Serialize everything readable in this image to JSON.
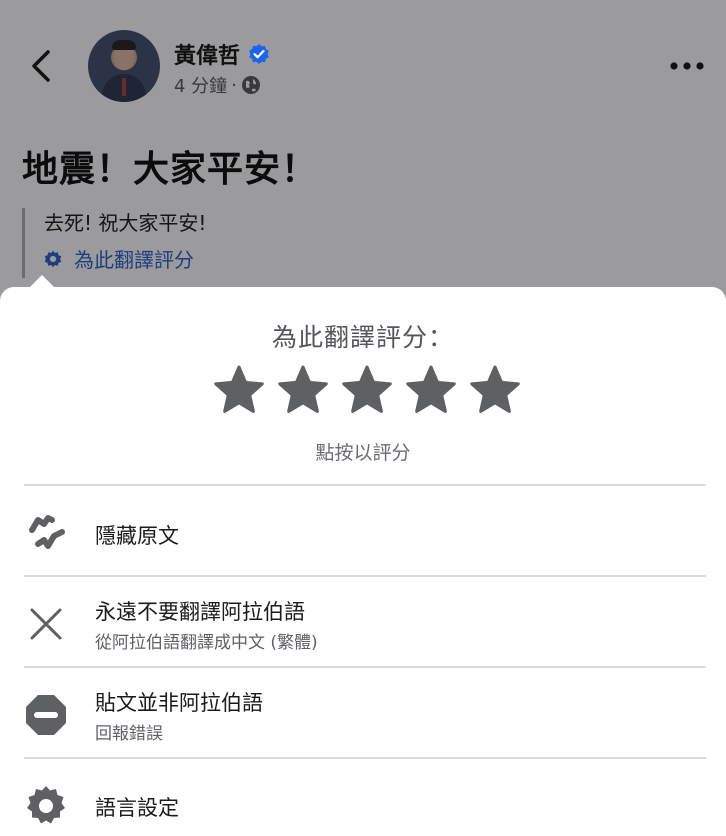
{
  "post": {
    "author": "黃偉哲",
    "time": "4 分鐘",
    "separator": "·",
    "content": "地震！大家平安！",
    "translation": "去死! 祝大家平安!",
    "rate_link": "為此翻譯評分"
  },
  "rating": {
    "title": "為此翻譯評分：",
    "hint": "點按以評分",
    "star_count": 5,
    "star_color": "#5f6064"
  },
  "menu": {
    "items": [
      {
        "label": "隱藏原文",
        "sub": "",
        "icon": "translate-arrows-icon"
      },
      {
        "label": "永遠不要翻譯阿拉伯語",
        "sub": "從阿拉伯語翻譯成中文 (繁體)",
        "icon": "close-x-icon"
      },
      {
        "label": "貼文並非阿拉伯語",
        "sub": "回報錯誤",
        "icon": "minus-circle-icon"
      },
      {
        "label": "語言設定",
        "sub": "",
        "icon": "gear-icon"
      }
    ]
  },
  "colors": {
    "verified": "#1b64f2",
    "link": "#1d3e7e",
    "icon_gray": "#5f6064"
  }
}
